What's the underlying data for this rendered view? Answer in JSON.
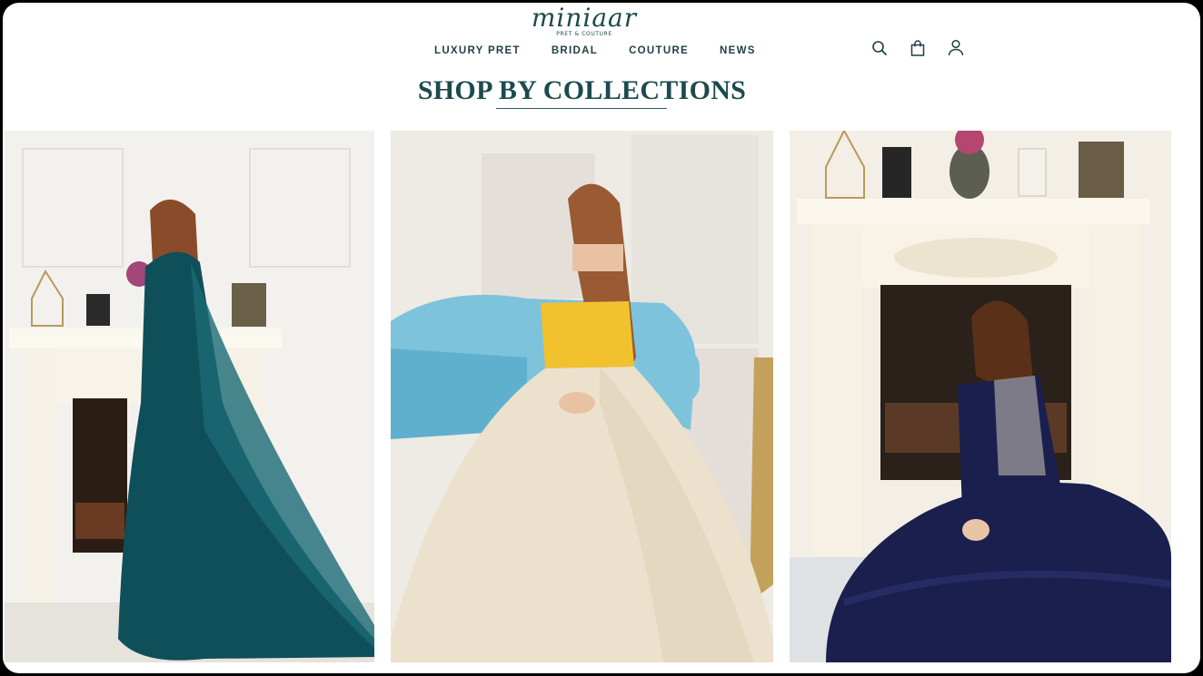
{
  "brand": {
    "name": "miniaar",
    "tagline": "PRET & COUTURE"
  },
  "nav": {
    "items": [
      "LUXURY PRET",
      "BRIDAL",
      "COUTURE",
      "NEWS"
    ]
  },
  "header_icons": [
    "search-icon",
    "shopping-bag-icon",
    "user-account-icon"
  ],
  "section": {
    "title": "SHOP BY COLLECTIONS"
  },
  "collections": [
    {
      "name": "teal-saree-collection",
      "dress_color": "#0f4f5a"
    },
    {
      "name": "yellow-lehenga-collection",
      "dress_color": "#f2c12e"
    },
    {
      "name": "navy-gown-collection",
      "dress_color": "#1a1f4d"
    }
  ],
  "colors": {
    "accent": "#1a4a4b",
    "background": "#ffffff"
  }
}
